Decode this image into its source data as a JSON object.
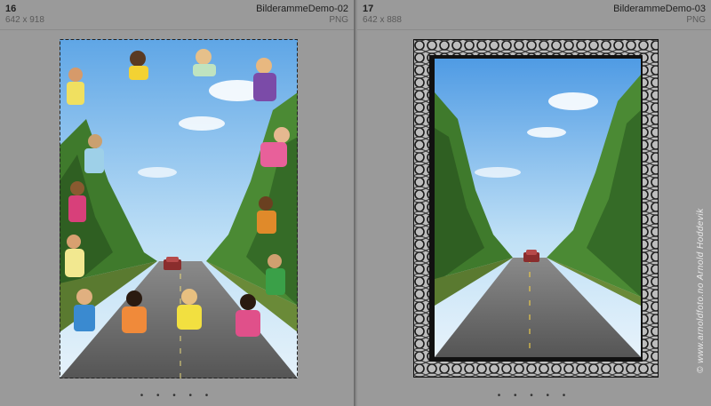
{
  "items": [
    {
      "index": "16",
      "dimensions": "642 x 918",
      "filename": "BilderammeDemo-02",
      "filetype": "PNG",
      "dots": "• • • • •"
    },
    {
      "index": "17",
      "dimensions": "642 x 888",
      "filename": "BilderammeDemo-03",
      "filetype": "PNG",
      "dots": "• • • • •"
    }
  ],
  "watermark": "© www.arnoldfoto.no Arnold Hoddevik",
  "colors": {
    "sky": "#8cc4ee",
    "road": "#6f6f6f",
    "trees": "#3f7a2c",
    "frame_ornament": "#cfcfcf",
    "cell_bg": "#9a9a9a"
  }
}
